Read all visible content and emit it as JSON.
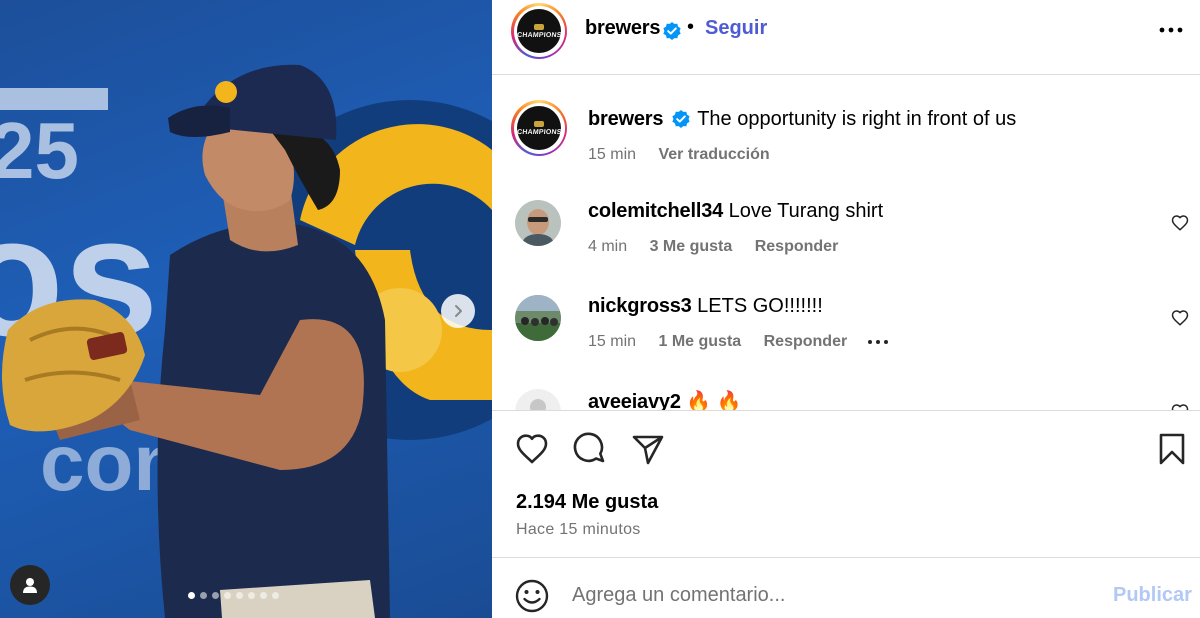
{
  "post": {
    "username": "brewers",
    "follow_label": "Seguir",
    "separator": "•",
    "logo_text": "CHAMPIONS",
    "caption_text": "The opportunity is right in front of us",
    "caption_time": "15 min",
    "translate_label": "Ver traducción"
  },
  "comments": [
    {
      "username": "colemitchell34",
      "text": "Love Turang shirt",
      "time": "4 min",
      "likes": "3 Me gusta",
      "reply_label": "Responder"
    },
    {
      "username": "nickgross3",
      "text": "LETS GO!!!!!!!",
      "time": "15 min",
      "likes": "1 Me gusta",
      "reply_label": "Responder"
    },
    {
      "username": "aveeiavy2",
      "text": "🔥 🔥"
    }
  ],
  "actions": {
    "likes_count": "2.194 Me gusta",
    "posted_ago": "Hace 15 minutos"
  },
  "comment_box": {
    "placeholder": "Agrega un comentario...",
    "publish_label": "Publicar"
  },
  "carousel": {
    "slide_count": 8,
    "active_index": 0
  },
  "colors": {
    "follow": "#4f5bd5",
    "verified": "#0095f6",
    "publish_disabled": "#b2c8f5",
    "muted": "#737373"
  },
  "icons": [
    "user-tag-icon",
    "chevron-right-icon",
    "more-icon",
    "verified-icon",
    "heart-icon",
    "comment-icon",
    "share-icon",
    "bookmark-icon",
    "emoji-icon"
  ]
}
